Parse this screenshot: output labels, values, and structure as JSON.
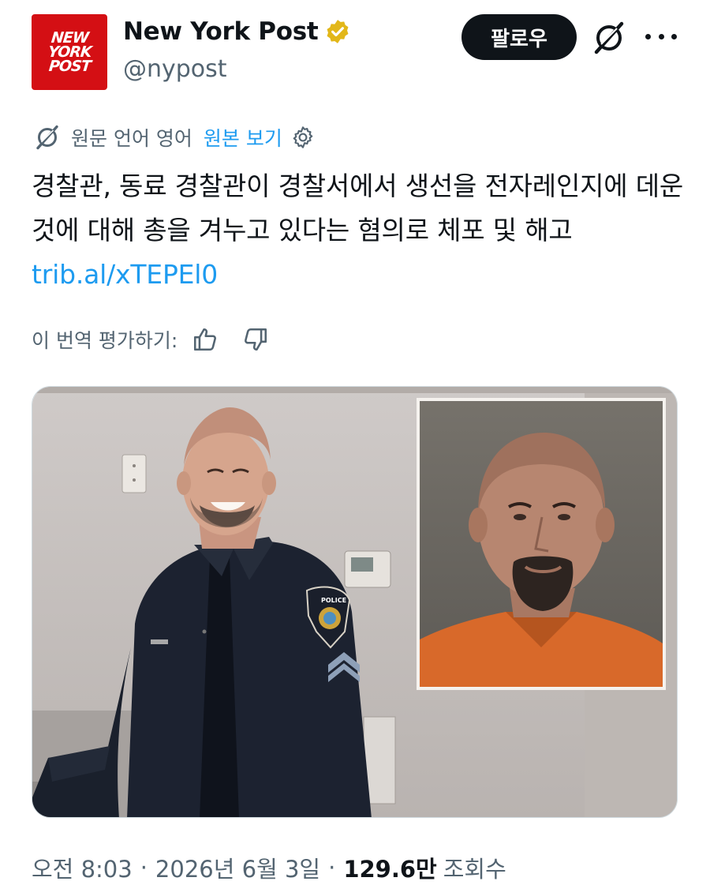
{
  "account": {
    "logo_lines": [
      "NEW",
      "YORK",
      "POST"
    ],
    "display_name": "New York Post",
    "handle": "@nypost",
    "verified_color": "#e2b719"
  },
  "actions": {
    "follow_label": "팔로우",
    "grok_icon": "grok-icon",
    "more_icon": "more-icon"
  },
  "translation": {
    "source_label": "원문 언어 영어",
    "view_original": "원본 보기",
    "settings_icon": "gear-icon"
  },
  "tweet": {
    "text": "경찰관, 동료 경찰관이 경찰서에서 생선을 전자레인지에 데운 것에 대해 총을 겨누고 있다는 혐의로 체포 및 해고 ",
    "link": "trib.al/xTEPEl0"
  },
  "rating": {
    "label": "이 번역 평가하기:",
    "like_icon": "thumbs-up-icon",
    "dislike_icon": "thumbs-down-icon"
  },
  "media": {
    "left_photo": "smiling police officer in uniform",
    "right_photo": "mugshot in orange jumpsuit",
    "badge_text": "POLICE"
  },
  "meta": {
    "time": "오전 8:03",
    "date": "2026년 6월 3일",
    "views_count": "129.6만",
    "views_label": "조회수"
  },
  "colors": {
    "accent": "#1d9bf0",
    "text": "#0f1419",
    "secondary": "#536471",
    "logo": "#d40f14"
  }
}
